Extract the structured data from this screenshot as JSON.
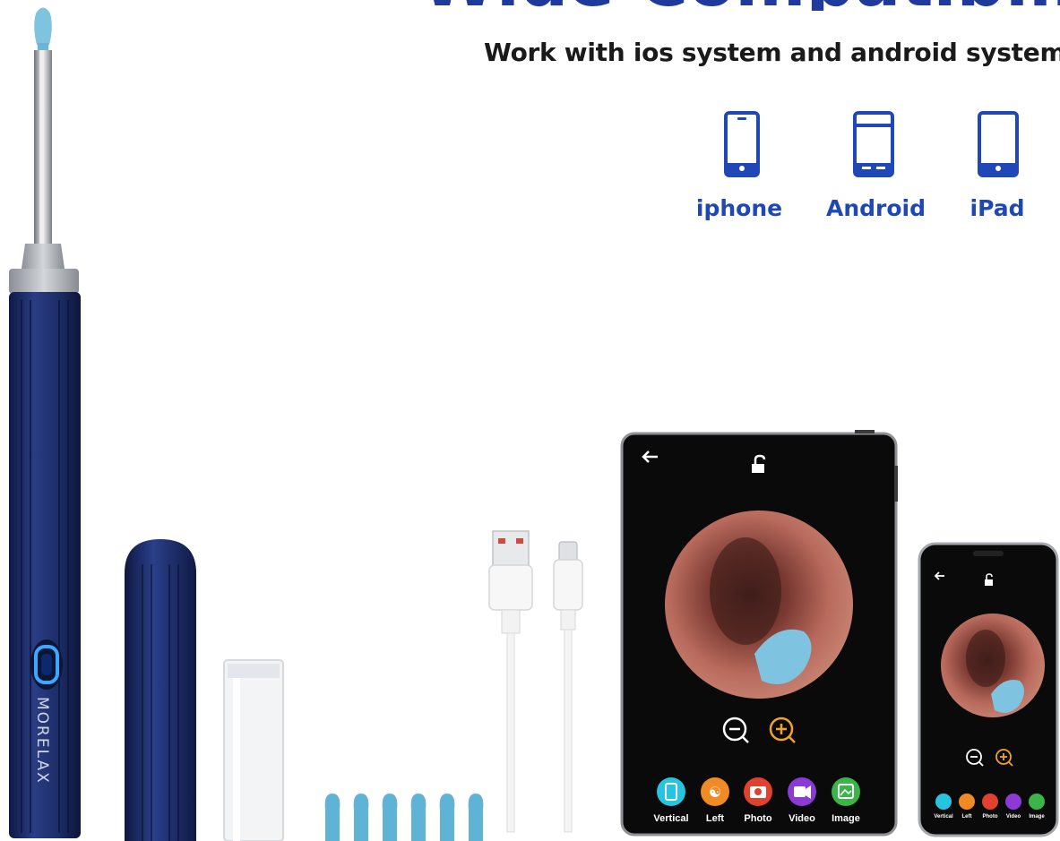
{
  "headline": "Wide Compatibility",
  "subtitle": "Work with ios system and android system",
  "devices": [
    {
      "icon": "phone-icon",
      "label": "iphone"
    },
    {
      "icon": "android-phone-icon",
      "label": "Android"
    },
    {
      "icon": "tablet-icon",
      "label": "iPad"
    }
  ],
  "brand": "MORELAX",
  "toolbar": {
    "vertical": "Vertical",
    "left": "Left",
    "photo": "Photo",
    "video": "Video",
    "image": "Image"
  },
  "colors": {
    "accent_blue": "#1f47b8",
    "device_navy": "#1c2c66",
    "tip_blue": "#7ec3e0"
  }
}
